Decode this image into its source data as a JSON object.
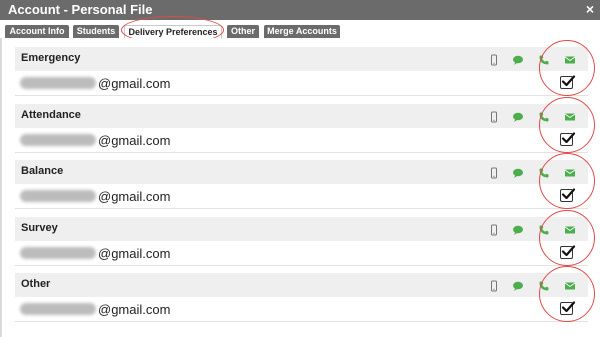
{
  "window": {
    "title": "Account - Personal File",
    "close_glyph": "×"
  },
  "tabs": [
    {
      "label": "Account Info",
      "active": false
    },
    {
      "label": "Students",
      "active": false
    },
    {
      "label": "Delivery Preferences",
      "active": true
    },
    {
      "label": "Other",
      "active": false
    },
    {
      "label": "Merge Accounts",
      "active": false
    }
  ],
  "colors": {
    "accent_green": "#4cae4c",
    "annotation_red": "#e24a4a",
    "header_bg": "#6b6b6b"
  },
  "icons": {
    "device": "mobile-phone-icon",
    "sms": "chat-bubble-icon",
    "voice": "phone-icon",
    "mail": "envelope-icon"
  },
  "sections": [
    {
      "label": "Emergency",
      "email_domain": "@gmail.com",
      "email_checked": true
    },
    {
      "label": "Attendance",
      "email_domain": "@gmail.com",
      "email_checked": true
    },
    {
      "label": "Balance",
      "email_domain": "@gmail.com",
      "email_checked": true
    },
    {
      "label": "Survey",
      "email_domain": "@gmail.com",
      "email_checked": true
    },
    {
      "label": "Other",
      "email_domain": "@gmail.com",
      "email_checked": true
    }
  ]
}
